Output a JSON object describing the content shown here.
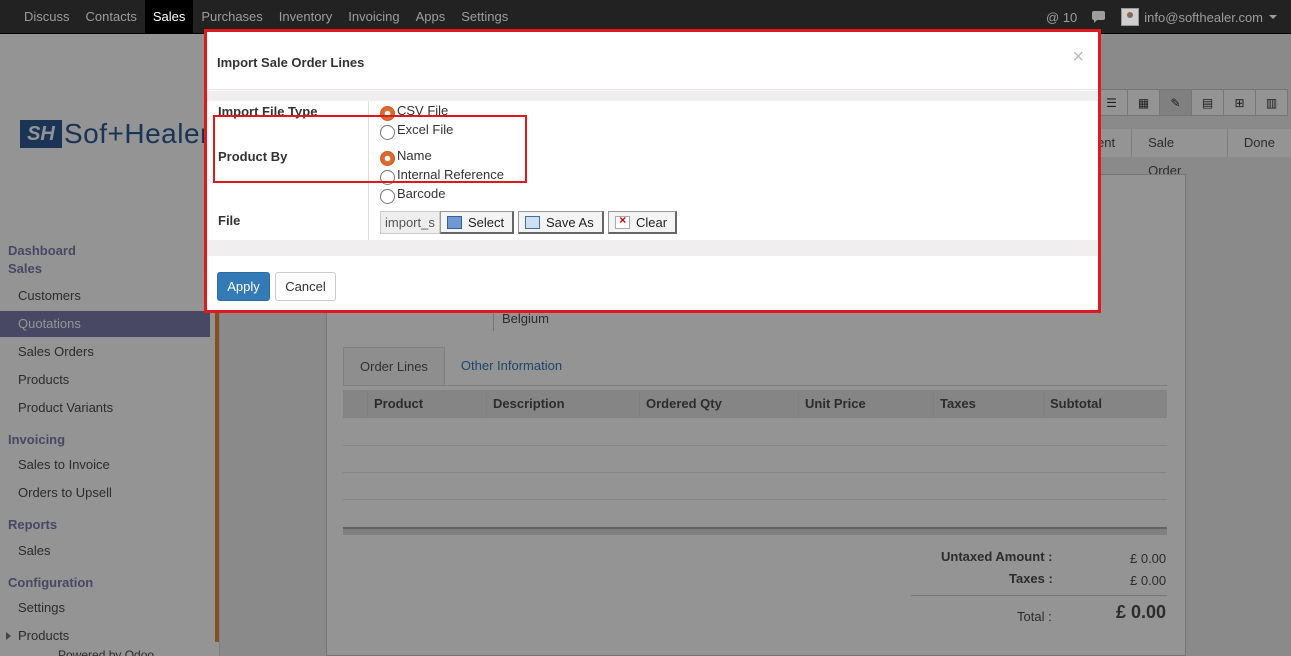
{
  "topbar": {
    "menu": [
      "Discuss",
      "Contacts",
      "Sales",
      "Purchases",
      "Inventory",
      "Invoicing",
      "Apps",
      "Settings"
    ],
    "active": "Sales",
    "notifications": "@ 10",
    "user_email": "info@softhealer.com"
  },
  "sidebar": {
    "logo_mark": "SH",
    "logo_text": "Sof+Healer",
    "dashboard": "Dashboard",
    "sales_head": "Sales",
    "sales_items": [
      "Customers",
      "Quotations",
      "Sales Orders",
      "Products",
      "Product Variants"
    ],
    "invoicing_head": "Invoicing",
    "invoicing_items": [
      "Sales to Invoice",
      "Orders to Upsell"
    ],
    "reports_head": "Reports",
    "reports_items": [
      "Sales"
    ],
    "config_head": "Configuration",
    "config_items": [
      "Settings",
      "Products"
    ],
    "powered": "Powered by Odoo"
  },
  "main": {
    "status_steps": [
      "ent",
      "Sale Order",
      "Done"
    ],
    "address_line": "Belgium",
    "tabs": [
      "Order Lines",
      "Other Information"
    ],
    "columns": [
      "Product",
      "Description",
      "Ordered Qty",
      "Unit Price",
      "Taxes",
      "Subtotal"
    ],
    "untaxed_label": "Untaxed Amount :",
    "untaxed_value": "£ 0.00",
    "taxes_label": "Taxes :",
    "taxes_value": "£ 0.00",
    "total_label": "Total :",
    "total_value": "£ 0.00"
  },
  "modal": {
    "title": "Import Sale Order Lines",
    "close": "×",
    "file_type_label": "Import File Type",
    "file_type_options": [
      "CSV File",
      "Excel File"
    ],
    "product_by_label": "Product By",
    "product_by_options": [
      "Name",
      "Internal Reference",
      "Barcode"
    ],
    "file_label": "File",
    "file_value": "import_s",
    "select_label": "Select",
    "save_as_label": "Save As",
    "clear_label": "Clear",
    "apply_label": "Apply",
    "cancel_label": "Cancel"
  }
}
